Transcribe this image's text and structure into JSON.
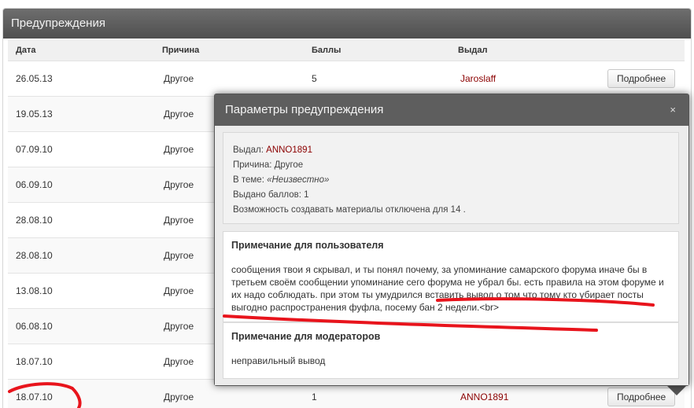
{
  "panel": {
    "title": "Предупреждения"
  },
  "table": {
    "headers": {
      "date": "Дата",
      "reason": "Причина",
      "points": "Баллы",
      "issuer": "Выдал"
    },
    "rows": [
      {
        "date": "26.05.13",
        "reason": "Другое",
        "points": "5",
        "issuer": "Jaroslaff",
        "button": "Подробнее"
      },
      {
        "date": "19.05.13",
        "reason": "Другое",
        "points": "",
        "issuer": "",
        "button": ""
      },
      {
        "date": "07.09.10",
        "reason": "Другое",
        "points": "",
        "issuer": "",
        "button": ""
      },
      {
        "date": "06.09.10",
        "reason": "Другое",
        "points": "",
        "issuer": "",
        "button": ""
      },
      {
        "date": "28.08.10",
        "reason": "Другое",
        "points": "",
        "issuer": "",
        "button": ""
      },
      {
        "date": "28.08.10",
        "reason": "Другое",
        "points": "",
        "issuer": "",
        "button": ""
      },
      {
        "date": "13.08.10",
        "reason": "Другое",
        "points": "",
        "issuer": "",
        "button": ""
      },
      {
        "date": "06.08.10",
        "reason": "Другое",
        "points": "",
        "issuer": "",
        "button": ""
      },
      {
        "date": "18.07.10",
        "reason": "Другое",
        "points": "",
        "issuer": "",
        "button": ""
      },
      {
        "date": "18.07.10",
        "reason": "Другое",
        "points": "1",
        "issuer": "ANNO1891",
        "button": "Подробнее"
      }
    ]
  },
  "modal": {
    "title": "Параметры предупреждения",
    "close": "×",
    "info": {
      "issuer_label": "Выдал: ",
      "issuer_value": "ANNO1891",
      "reason": "Причина: Другое",
      "topic_label": "В теме: ",
      "topic_value": "«Неизвестно»",
      "points": "Выдано баллов: 1",
      "restriction": "Возможность создавать материалы отключена для 14 ."
    },
    "user_note": {
      "title": "Примечание для пользователя",
      "text": "сообщения твои я скрывал, и ты понял почему, за упоминание самарского форума иначе бы в третьем своём сообщении упоминание сего форума не убрал бы. есть правила на этом форуме и их надо соблюдать. при этом ты умудрился вставить вывод о том что тому кто убирает посты выгодно распространения фуфла, посему бан 2 недели.<br>"
    },
    "mod_note": {
      "title": "Примечание для модераторов",
      "text": "неправильный вывод"
    }
  },
  "colors": {
    "annotation": "#e8141c",
    "issuer": "#8b0000",
    "header_bg": "#5e5e5e"
  }
}
